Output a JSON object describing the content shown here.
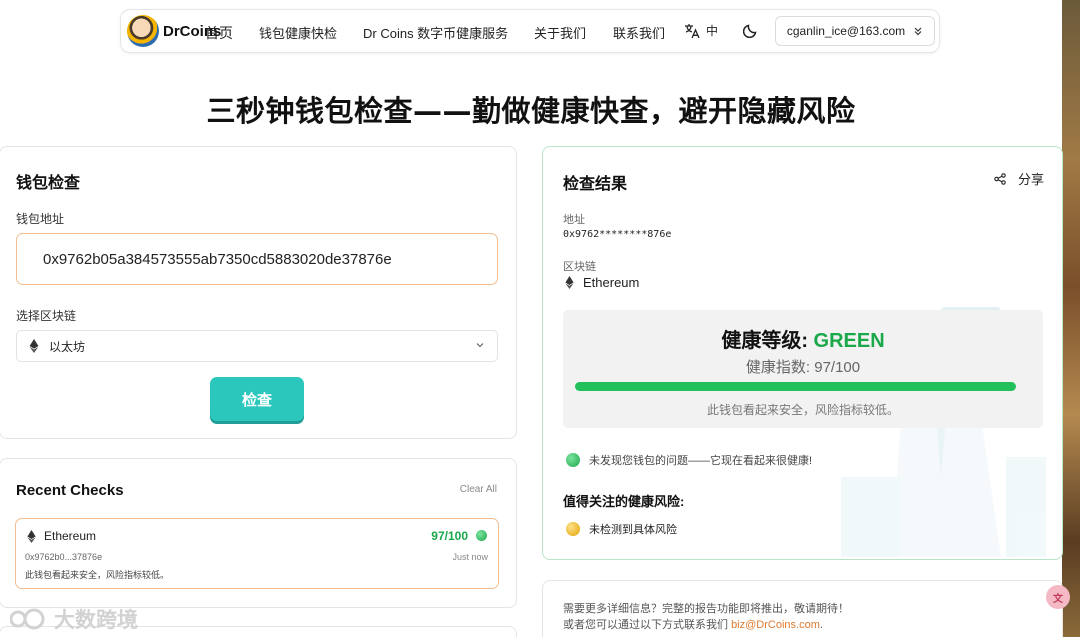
{
  "nav": {
    "brand": "DrCoins",
    "home": "首页",
    "links": [
      "钱包健康快检",
      "Dr Coins 数字币健康服务",
      "关于我们",
      "联系我们"
    ],
    "lang": "中",
    "account": "cganlin_ice@163.com"
  },
  "headline": "三秒钟钱包检查——勤做健康快查，避开隐藏风险",
  "wallet_check": {
    "title": "钱包检查",
    "address_label": "钱包地址",
    "address_value": "0x9762b05a384573555ab7350cd5883020de37876e",
    "chain_label": "选择区块链",
    "chain_value": "以太坊",
    "check_button": "检查"
  },
  "recent": {
    "title": "Recent Checks",
    "clear": "Clear All",
    "items": [
      {
        "chain": "Ethereum",
        "score": "97/100",
        "address": "0x9762b0...37876e",
        "time": "Just now",
        "note": "此钱包看起来安全，风险指标较低。"
      }
    ]
  },
  "result": {
    "title": "检查结果",
    "share": "分享",
    "address_label": "地址",
    "address_value": "0x9762********876e",
    "chain_label": "区块链",
    "chain_value": "Ethereum",
    "grade_label": "健康等级: ",
    "grade_value": "GREEN",
    "score_text": "健康指数: 97/100",
    "score": 0.97,
    "summary": "此钱包看起来安全，风险指标较低。",
    "finding": "未发现您钱包的问题——它现在看起来很健康!",
    "risks_title": "值得关注的健康风险:",
    "risk_item": "未检测到具体风险"
  },
  "contact": {
    "line1": "需要更多详细信息？完整的报告功能即将推出，敬请期待！",
    "line2": "或者您可以通过以下方式联系我们 ",
    "email": "biz@DrCoins.com",
    "period": "."
  },
  "watermark": "大数跨境",
  "colors": {
    "accent": "#2bc7bd",
    "green": "#1aa84a",
    "bar": "#21c05a",
    "input_border": "#f3bd8f"
  }
}
